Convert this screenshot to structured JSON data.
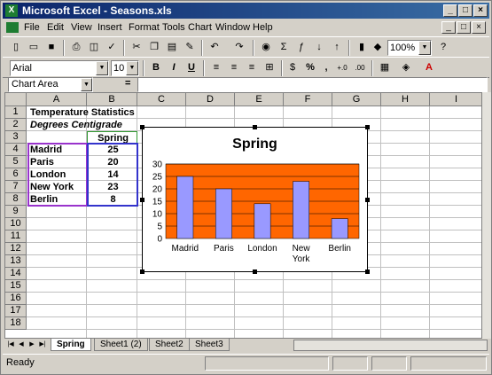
{
  "window": {
    "title": "Microsoft Excel - Seasons.xls",
    "controls": {
      "minimize": "_",
      "maximize": "□",
      "close": "×"
    }
  },
  "menu": [
    "File",
    "Edit",
    "View",
    "Insert",
    "Format",
    "Tools",
    "Chart",
    "Window",
    "Help"
  ],
  "toolbar": {
    "zoom": "100%",
    "font_name": "Arial",
    "font_size": "10",
    "bold": "B",
    "italic": "I",
    "underline": "U",
    "percent": "%",
    "comma": ",",
    "help": "?"
  },
  "formula_bar": {
    "name_box": "Chart Area",
    "equals": "=",
    "content": ""
  },
  "columns": [
    "A",
    "B",
    "C",
    "D",
    "E",
    "F",
    "G",
    "H",
    "I"
  ],
  "rows": [
    "1",
    "2",
    "3",
    "4",
    "5",
    "6",
    "7",
    "8",
    "9",
    "10",
    "11",
    "12",
    "13",
    "14",
    "15",
    "16",
    "17",
    "18"
  ],
  "cells": {
    "A1": "Temperature Statistics",
    "A2": "Degrees Centigrade",
    "B3": "Spring",
    "A4": "Madrid",
    "B4": "25",
    "A5": "Paris",
    "B5": "20",
    "A6": "London",
    "B6": "14",
    "A7": "New York",
    "B7": "23",
    "A8": "Berlin",
    "B8": "8"
  },
  "chart_data": {
    "type": "bar",
    "title": "Spring",
    "categories": [
      "Madrid",
      "Paris",
      "London",
      "New York",
      "Berlin"
    ],
    "values": [
      25,
      20,
      14,
      23,
      8
    ],
    "ylim": [
      0,
      30
    ],
    "yticks": [
      0,
      5,
      10,
      15,
      20,
      25,
      30
    ],
    "grid": true,
    "xlabel": "",
    "ylabel": "",
    "bar_color": "#9999ff",
    "plot_background": "#ff6600"
  },
  "sheets": [
    "Spring",
    "Sheet1 (2)",
    "Sheet2",
    "Sheet3"
  ],
  "active_sheet": "Spring",
  "status": "Ready",
  "colors": {
    "titlebar": "#0a246a",
    "chrome": "#d4d0c8",
    "selection_purple": "#9933cc",
    "selection_blue": "#3333cc"
  }
}
